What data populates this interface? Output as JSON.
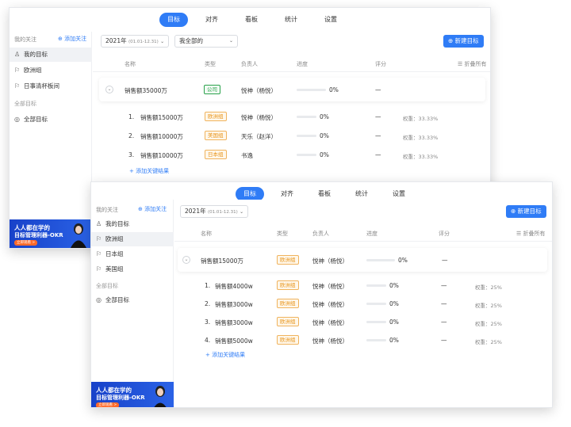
{
  "nav_tabs": [
    "目标",
    "对齐",
    "看板",
    "统计",
    "设置"
  ],
  "active_tab": 0,
  "colors": {
    "accent": "#2f7cf6",
    "company_tag": "#2ba24c",
    "team_tag": "#e8961e",
    "banner": "#1842c9"
  },
  "windowA": {
    "sidebar": {
      "header": "我的关注",
      "add_follow": "⊕ 添加关注",
      "items": [
        {
          "icon": "user-icon",
          "glyph": "♙",
          "label": "我的目标",
          "active": true
        },
        {
          "icon": "flag-icon",
          "glyph": "⚐",
          "label": "欧洲组",
          "active": false
        },
        {
          "icon": "flag-icon",
          "glyph": "⚐",
          "label": "日事清杯板间",
          "active": false
        }
      ],
      "group_label": "全部目标",
      "all_goals": {
        "icon": "target-icon",
        "glyph": "◎",
        "label": "全部目标"
      }
    },
    "toolbar": {
      "year": "2021年",
      "year_range": "(01.01-12.31)",
      "scope": "我全部的",
      "new_button": "⊕ 新建目标"
    },
    "columns": {
      "name": "名称",
      "type": "类型",
      "owner": "负责人",
      "progress": "进度",
      "score": "评分",
      "collapse": "☰ 折叠所有"
    },
    "objective": {
      "name": "销售额35000万",
      "tag": "公司",
      "tag_color": "green",
      "owner": "悦神（杨悦）",
      "progress": 0,
      "progress_text": "0%",
      "score": "—"
    },
    "key_results": [
      {
        "index": "1.",
        "name": "销售额15000万",
        "tag": "欧洲组",
        "owner": "悦神（杨悦）",
        "progress": 0,
        "progress_text": "0%",
        "score": "—",
        "weight": "权重：33.33%"
      },
      {
        "index": "2.",
        "name": "销售额10000万",
        "tag": "美国组",
        "owner": "天乐（赵洋）",
        "progress": 0,
        "progress_text": "0%",
        "score": "—",
        "weight": "权重：33.33%"
      },
      {
        "index": "3.",
        "name": "销售额10000万",
        "tag": "日本组",
        "owner": "书逸",
        "progress": 0,
        "progress_text": "0%",
        "score": "—",
        "weight": "权重：33.33%"
      }
    ],
    "add_kr": "+ 添加关键结果",
    "banner": {
      "line1": "人人都在学的",
      "line2": "目标管理利器-OKR",
      "pill": "立即观看 >"
    }
  },
  "windowB": {
    "sidebar": {
      "header": "我的关注",
      "add_follow": "⊕ 添加关注",
      "items": [
        {
          "icon": "user-icon",
          "glyph": "♙",
          "label": "我的目标",
          "active": false
        },
        {
          "icon": "flag-icon",
          "glyph": "⚐",
          "label": "欧洲组",
          "active": true
        },
        {
          "icon": "flag-icon",
          "glyph": "⚐",
          "label": "日本组",
          "active": false
        },
        {
          "icon": "flag-icon",
          "glyph": "⚐",
          "label": "美国组",
          "active": false
        }
      ],
      "group_label": "全部目标",
      "all_goals": {
        "icon": "target-icon",
        "glyph": "◎",
        "label": "全部目标"
      }
    },
    "toolbar": {
      "year": "2021年",
      "year_range": "(01.01-12.31)",
      "new_button": "⊕ 新建目标"
    },
    "columns": {
      "name": "名称",
      "type": "类型",
      "owner": "负责人",
      "progress": "进度",
      "score": "评分",
      "collapse": "☰ 折叠所有"
    },
    "objective": {
      "name": "销售额15000万",
      "tag": "欧洲组",
      "tag_color": "orange",
      "owner": "悦神（杨悦）",
      "progress": 0,
      "progress_text": "0%",
      "score": "—"
    },
    "key_results": [
      {
        "index": "1.",
        "name": "销售额4000w",
        "tag": "欧洲组",
        "owner": "悦神（杨悦）",
        "progress": 0,
        "progress_text": "0%",
        "score": "—",
        "weight": "权重：25%"
      },
      {
        "index": "2.",
        "name": "销售额3000w",
        "tag": "欧洲组",
        "owner": "悦神（杨悦）",
        "progress": 0,
        "progress_text": "0%",
        "score": "—",
        "weight": "权重：25%"
      },
      {
        "index": "3.",
        "name": "销售额3000w",
        "tag": "欧洲组",
        "owner": "悦神（杨悦）",
        "progress": 0,
        "progress_text": "0%",
        "score": "—",
        "weight": "权重：25%"
      },
      {
        "index": "4.",
        "name": "销售额5000w",
        "tag": "欧洲组",
        "owner": "悦神（杨悦）",
        "progress": 0,
        "progress_text": "0%",
        "score": "—",
        "weight": "权重：25%"
      }
    ],
    "add_kr": "+ 添加关键结果",
    "banner": {
      "line1": "人人都在学的",
      "line2": "目标管理利器-OKR",
      "pill": "立即观看 >"
    }
  }
}
